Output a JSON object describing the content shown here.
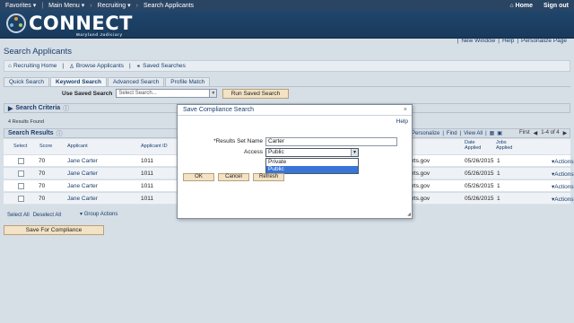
{
  "topbar": {
    "menus": [
      "Favorites",
      "Main Menu",
      "Recruiting",
      "Search Applicants"
    ],
    "home": "Home",
    "signout": "Sign out"
  },
  "brand": {
    "name": "CONNECT",
    "sub": "Maryland Judiciary"
  },
  "util_links": [
    "New Window",
    "Help",
    "Personalize Page"
  ],
  "page_title": "Search Applicants",
  "nav": {
    "recruiting_home": "Recruiting Home",
    "browse": "Browse Applicants",
    "saved": "Saved Searches"
  },
  "tabs": [
    "Quick Search",
    "Keyword Search",
    "Advanced Search",
    "Profile Match"
  ],
  "saved_search": {
    "label": "Use Saved Search",
    "placeholder": "Select Search...",
    "run_label": "Run Saved Search"
  },
  "criteria_title": "Search Criteria",
  "results_found": "4 Results Found",
  "results_title": "Search Results",
  "grid_tools": {
    "personalize": "Personalize",
    "find": "Find",
    "view_all": "View All"
  },
  "pager": {
    "first": "First",
    "range": "1-4 of 4"
  },
  "columns": {
    "select": "Select",
    "score": "Score",
    "applicant": "Applicant",
    "applicant_id": "Applicant ID",
    "date_applied": "Date Applied",
    "job_applied": "Jobs Applied"
  },
  "rows": [
    {
      "score": "70",
      "name": "Jane Carter",
      "id": "1011",
      "email_tail": "urts.gov",
      "date": "05/26/2015",
      "jobs": "1",
      "actions": "Actions"
    },
    {
      "score": "70",
      "name": "Jane Carter",
      "id": "1011",
      "email_tail": "urts.gov",
      "date": "05/26/2015",
      "jobs": "1",
      "actions": "Actions"
    },
    {
      "score": "70",
      "name": "Jane Carter",
      "id": "1011",
      "email_tail": "urts.gov",
      "date": "05/26/2015",
      "jobs": "1",
      "actions": "Actions"
    },
    {
      "score": "70",
      "name": "Jane Carter",
      "id": "1011",
      "email_tail": "urts.gov",
      "date": "05/26/2015",
      "jobs": "1",
      "actions": "Actions"
    }
  ],
  "select_all": "Select All",
  "deselect_all": "Deselect All",
  "group_actions": "Group Actions",
  "compliance_button": "Save For Compliance",
  "dialog": {
    "title": "Save Compliance Search",
    "help": "Help",
    "name_label": "*Results Set Name",
    "name_value": "Carter",
    "access_label": "Access",
    "access_value": "Public",
    "options": [
      "Private",
      "Public"
    ],
    "ok": "OK",
    "cancel": "Cancel",
    "refresh": "Refresh"
  }
}
